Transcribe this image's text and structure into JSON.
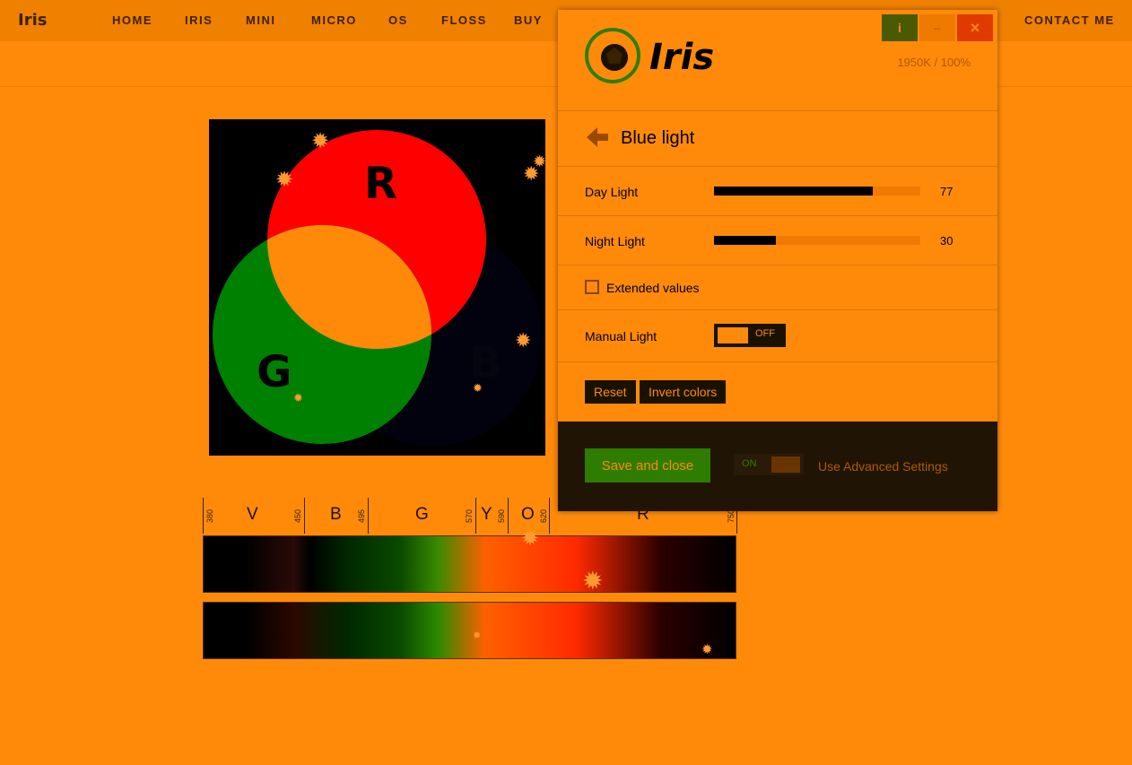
{
  "site": {
    "brand": "Iris",
    "nav": [
      "HOME",
      "IRIS",
      "MINI",
      "MICRO",
      "OS",
      "FLOSS",
      "BUY",
      "CONTACT ME"
    ]
  },
  "diagram": {
    "letters": {
      "r": "R",
      "g": "G",
      "b": "B"
    }
  },
  "spectrum": {
    "tick_labels": [
      "380",
      "450",
      "495",
      "570",
      "590",
      "620",
      "750"
    ],
    "band_letters": [
      "V",
      "B",
      "G",
      "Y",
      "O",
      "R"
    ]
  },
  "panel": {
    "logo_text": "Iris",
    "window_buttons": {
      "info": "i",
      "minimize": "–",
      "close": "×"
    },
    "status": "1950K / 100%",
    "section_title": "Blue light",
    "day_light": {
      "label": "Day Light",
      "value": 77,
      "value_text": "77"
    },
    "night_light": {
      "label": "Night Light",
      "value": 30,
      "value_text": "30"
    },
    "extended_values_label": "Extended values",
    "extended_values_checked": false,
    "manual_light": {
      "label": "Manual Light",
      "state": "OFF"
    },
    "buttons": {
      "reset": "Reset",
      "invert": "Invert colors"
    },
    "footer": {
      "save_label": "Save and close",
      "advanced_toggle_state": "ON",
      "advanced_label": "Use Advanced Settings"
    },
    "colors": {
      "accent": "#ff8a0a",
      "green": "#2e7d00",
      "dark": "#1a1200",
      "close": "#e03a00"
    }
  }
}
